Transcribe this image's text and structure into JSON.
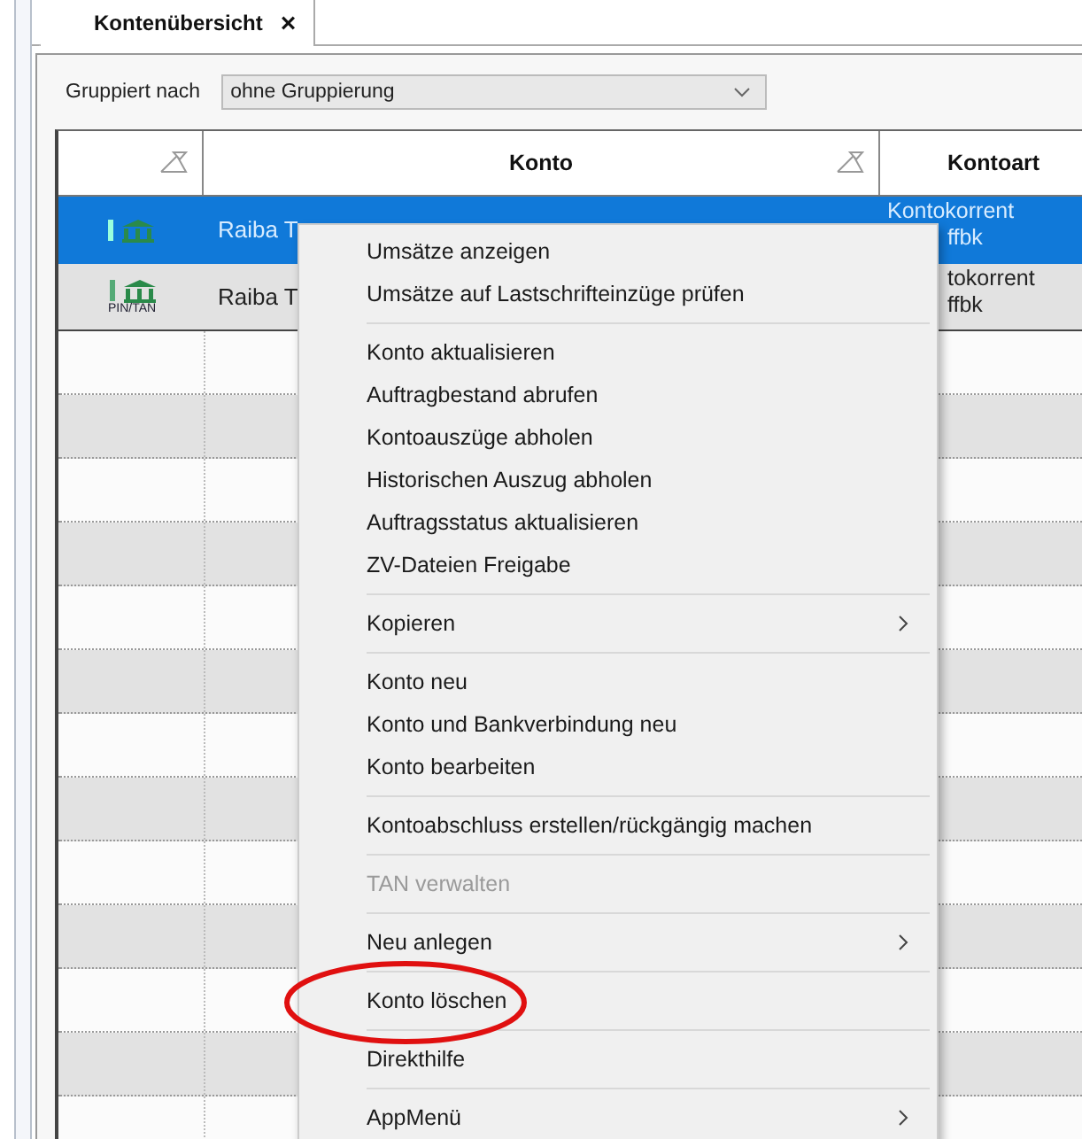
{
  "tab": {
    "title": "Kontenübersicht",
    "close": "×",
    "selected": true
  },
  "grouping": {
    "label": "Gruppiert nach",
    "value": "ohne Gruppierung"
  },
  "table": {
    "columns": [
      {
        "filter": true
      },
      {
        "label": "Konto",
        "filter": true
      },
      {
        "label": "Kontoart"
      }
    ],
    "rows": [
      {
        "selected": true,
        "account": "Raiba T",
        "type_lines": [
          {
            "text": "Kontokorrent",
            "covered": false
          },
          {
            "text": "ffbk",
            "covered": true
          }
        ]
      },
      {
        "selected": false,
        "icon_label": "PIN/TAN",
        "account": "Raiba T",
        "type_lines": [
          {
            "text": "tokorrent",
            "covered": true
          },
          {
            "text": "ffbk",
            "covered": true
          }
        ]
      }
    ]
  },
  "context_menu": {
    "groups": [
      [
        {
          "label": "Umsätze anzeigen",
          "disabled": false,
          "submenu": false
        },
        {
          "label": "Umsätze auf Lastschrifteinzüge prüfen",
          "disabled": false,
          "submenu": false
        }
      ],
      [
        {
          "label": "Konto aktualisieren",
          "disabled": false,
          "submenu": false
        },
        {
          "label": "Auftragbestand abrufen",
          "disabled": false,
          "submenu": false
        },
        {
          "label": "Kontoauszüge abholen",
          "disabled": false,
          "submenu": false
        },
        {
          "label": "Historischen Auszug abholen",
          "disabled": false,
          "submenu": false
        },
        {
          "label": "Auftragsstatus aktualisieren",
          "disabled": false,
          "submenu": false
        },
        {
          "label": "ZV-Dateien Freigabe",
          "disabled": false,
          "submenu": false
        }
      ],
      [
        {
          "label": "Kopieren",
          "disabled": false,
          "submenu": true
        }
      ],
      [
        {
          "label": "Konto neu",
          "disabled": false,
          "submenu": false
        },
        {
          "label": "Konto und Bankverbindung neu",
          "disabled": false,
          "submenu": false
        },
        {
          "label": "Konto bearbeiten",
          "disabled": false,
          "submenu": false
        }
      ],
      [
        {
          "label": "Kontoabschluss erstellen/rückgängig machen",
          "disabled": false,
          "submenu": false
        }
      ],
      [
        {
          "label": "TAN verwalten",
          "disabled": true,
          "submenu": false
        }
      ],
      [
        {
          "label": "Neu anlegen",
          "disabled": false,
          "submenu": true
        }
      ],
      [
        {
          "label": "Konto löschen",
          "disabled": false,
          "submenu": false,
          "circled": true
        }
      ],
      [
        {
          "label": "Direkthilfe",
          "disabled": false,
          "submenu": false
        }
      ],
      [
        {
          "label": "AppMenü",
          "disabled": false,
          "submenu": true
        }
      ]
    ]
  }
}
